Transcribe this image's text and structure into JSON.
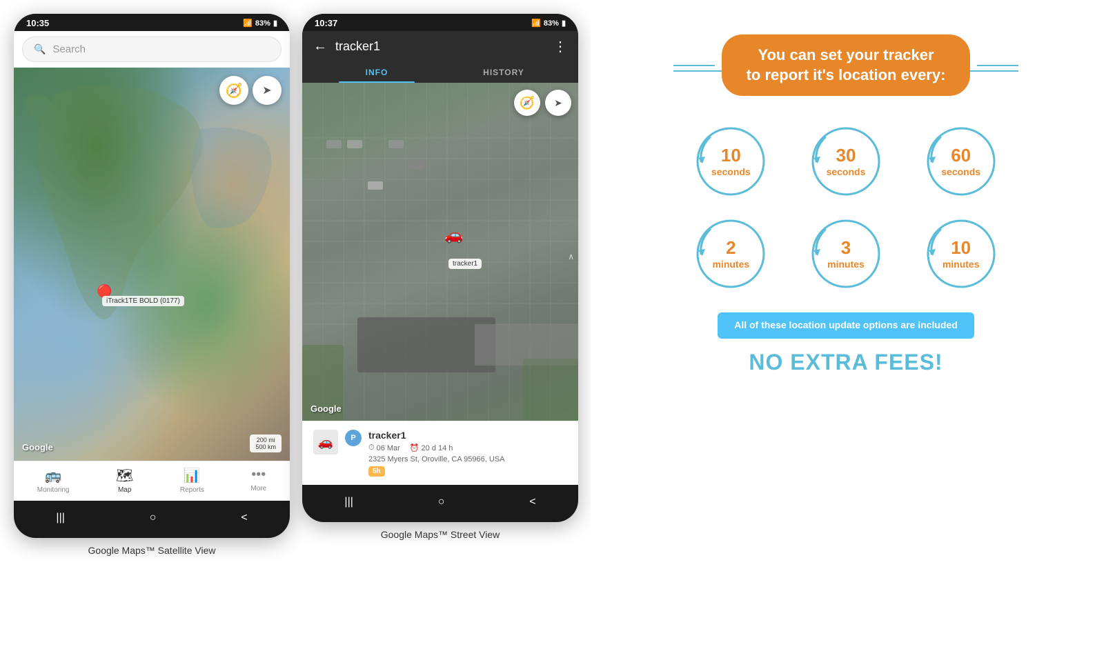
{
  "phone1": {
    "status_bar": {
      "time": "10:35",
      "signal": "📶",
      "network": ".ill",
      "battery": "83%",
      "battery_icon": "🔋"
    },
    "search": {
      "placeholder": "Search"
    },
    "map": {
      "watermark": "Google",
      "scale_line1": "200 mi",
      "scale_line2": "500 km",
      "pin_label": "iTrack1TE BOLD (0177)",
      "compass_icon": "🧭",
      "direction_icon": "➤"
    },
    "nav_items": [
      {
        "icon": "🚌",
        "label": "Monitoring",
        "active": false
      },
      {
        "icon": "🗺",
        "label": "Map",
        "active": true
      },
      {
        "icon": "📊",
        "label": "Reports",
        "active": false
      },
      {
        "icon": "•••",
        "label": "More",
        "active": false
      }
    ],
    "system_nav": [
      "|||",
      "○",
      "<"
    ]
  },
  "phone2": {
    "status_bar": {
      "time": "10:37",
      "battery": "83%"
    },
    "header": {
      "back_icon": "←",
      "title": "tracker1",
      "more_icon": "⋮"
    },
    "tabs": [
      {
        "label": "INFO",
        "active": true
      },
      {
        "label": "HISTORY",
        "active": false
      }
    ],
    "map": {
      "watermark": "Google",
      "car_icon": "🚗",
      "pin_label": "tracker1",
      "compass_icon": "🧭",
      "direction_icon": "➤"
    },
    "tracker_card": {
      "name": "tracker1",
      "date": "06 Mar",
      "duration": "20 d 14 h",
      "address": "2325 Myers St, Oroville, CA 95966, USA",
      "time_ago": "5h",
      "parking_icon": "P"
    },
    "system_nav": [
      "|||",
      "○",
      "<"
    ]
  },
  "info_panel": {
    "headline": "You can set your tracker\nto report it's location every:",
    "line_color": "#5abcd8",
    "headline_bg": "#e8872a",
    "circles": [
      {
        "number": "10",
        "unit": "seconds"
      },
      {
        "number": "30",
        "unit": "seconds"
      },
      {
        "number": "60",
        "unit": "seconds"
      },
      {
        "number": "2",
        "unit": "minutes"
      },
      {
        "number": "3",
        "unit": "minutes"
      },
      {
        "number": "10",
        "unit": "minutes"
      }
    ],
    "included_text": "All of these location update options are included",
    "no_fees_text": "NO EXTRA FEES!"
  },
  "captions": {
    "left": "Google Maps™ Satellite View",
    "right": "Google Maps™ Street View"
  }
}
